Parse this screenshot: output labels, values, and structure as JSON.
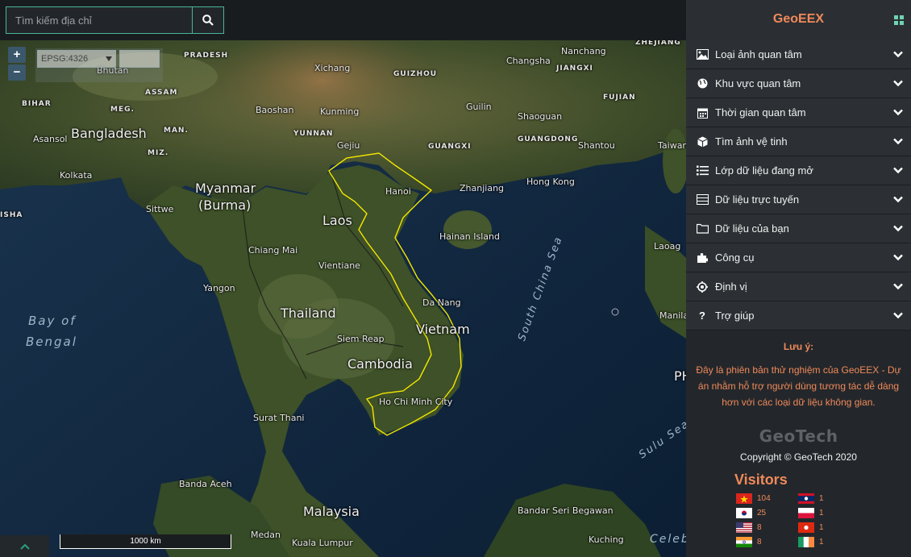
{
  "search": {
    "placeholder": "Tìm kiếm địa chỉ"
  },
  "map": {
    "zoom_in": "+",
    "zoom_out": "−",
    "projection": "EPSG:4326",
    "projection_extra": "",
    "scale_label": "1000 km",
    "labels": {
      "countries": [
        "Bangladesh",
        "Myanmar",
        "(Burma)",
        "Laos",
        "Thailand",
        "Vietnam",
        "Cambodia",
        "Malaysia",
        "Bhutan",
        "PH"
      ],
      "cities": [
        "Xichang",
        "Changsha",
        "Nanchang",
        "Kolkata",
        "Asansol",
        "Baoshan",
        "Kunming",
        "Guilin",
        "Shaoguan",
        "Gejiu",
        "Shantou",
        "Taiwan",
        "Hanoi",
        "Zhanjiang",
        "Hong Kong",
        "Sittwe",
        "Chiang Mai",
        "Vientiane",
        "Hainan Island",
        "Laoag",
        "Yangon",
        "Da Nang",
        "Siem Reap",
        "Manila",
        "Ho Chi Minh City",
        "Surat Thani",
        "Banda Aceh",
        "Bandar Seri Begawan",
        "Medan",
        "Kuala Lumpur",
        "Kuching"
      ],
      "regions": [
        "ZHEJIANG",
        "PRADESH",
        "ASSAM",
        "GUIZHOU",
        "JIANGXI",
        "FUJIAN",
        "BIHAR",
        "MEG.",
        "MAN.",
        "YUNNAN",
        "GUANGXI",
        "GUANGDONG",
        "MIZ.",
        "ISHA"
      ],
      "seas": [
        "Bay of",
        "Bengal",
        "South China Sea",
        "Sulu Sea",
        "Celeb"
      ]
    }
  },
  "sidebar": {
    "title": "GeoEEX",
    "items": [
      {
        "label": "Loại ảnh quan tâm",
        "icon": "image-icon"
      },
      {
        "label": "Khu vực quan tâm",
        "icon": "globe-icon"
      },
      {
        "label": "Thời gian quan tâm",
        "icon": "calendar-icon"
      },
      {
        "label": "Tìm ảnh vệ tinh",
        "icon": "cube-icon"
      },
      {
        "label": "Lớp dữ liệu đang mở",
        "icon": "list-icon"
      },
      {
        "label": "Dữ liệu trực tuyến",
        "icon": "server-icon"
      },
      {
        "label": "Dữ liệu của bạn",
        "icon": "folder-icon"
      },
      {
        "label": "Công cụ",
        "icon": "puzzle-icon"
      },
      {
        "label": "Định vị",
        "icon": "crosshair-icon"
      },
      {
        "label": "Trợ giúp",
        "icon": "question-icon"
      }
    ],
    "note_title": "Lưu ý:",
    "note_body": "Đây là phiên bản thử nghiệm của GeoEEX - Dự án nhằm hỗ trợ người dùng tương tác dễ dàng hơn với các loại dữ liệu không gian.",
    "brand": "GeoTech",
    "copyright": "Copyright © GeoTech 2020",
    "visitors_title": "Visitors",
    "visitors": [
      {
        "country": "vn-flag",
        "count": "104"
      },
      {
        "country": "la-flag",
        "count": "1"
      },
      {
        "country": "kr-flag",
        "count": "25"
      },
      {
        "country": "pl-flag",
        "count": "1"
      },
      {
        "country": "us-flag",
        "count": "8"
      },
      {
        "country": "hk-flag",
        "count": "1"
      },
      {
        "country": "in-flag",
        "count": "8"
      },
      {
        "country": "ie-flag",
        "count": "1"
      }
    ]
  },
  "colors": {
    "accent": "#f0895a",
    "search_border": "#48b69a",
    "vietnam_outline": "#f2e600"
  }
}
